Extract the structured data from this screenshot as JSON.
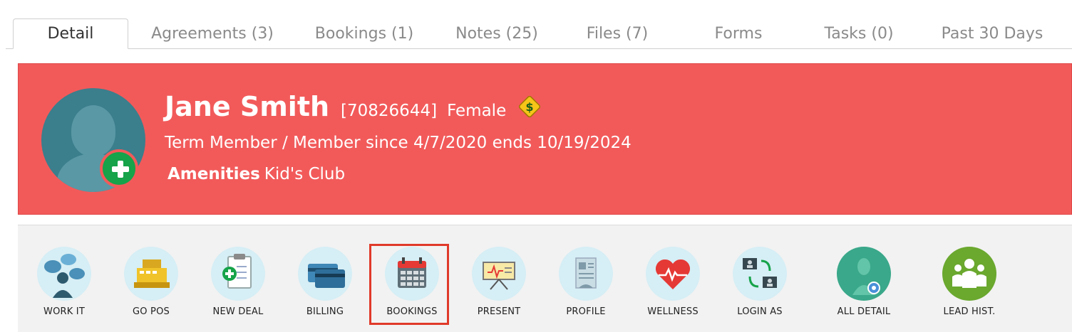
{
  "tabs": [
    {
      "label": "Detail",
      "active": true
    },
    {
      "label": "Agreements (3)"
    },
    {
      "label": "Bookings (1)"
    },
    {
      "label": "Notes (25)"
    },
    {
      "label": "Files (7)"
    },
    {
      "label": "Forms"
    },
    {
      "label": "Tasks (0)"
    },
    {
      "label": "Past 30 Days"
    }
  ],
  "member": {
    "name": "Jane Smith",
    "id": "[70826644]",
    "gender": "Female",
    "status_icon": "dollar-sign-warning-icon",
    "term": "Term Member / Member since 4/7/2020 ends 10/19/2024",
    "amenities_label": "Amenities",
    "amenities_value": "Kid's Club",
    "banner_color": "#f25a5a"
  },
  "toolbar": {
    "items": [
      {
        "label": "WORK IT",
        "icon": "chat-person-icon"
      },
      {
        "label": "GO POS",
        "icon": "cash-register-icon"
      },
      {
        "label": "NEW DEAL",
        "icon": "clipboard-plus-icon"
      },
      {
        "label": "BILLING",
        "icon": "credit-card-icon"
      },
      {
        "label": "BOOKINGS",
        "icon": "calendar-icon",
        "highlighted": true
      },
      {
        "label": "PRESENT",
        "icon": "presentation-board-icon"
      },
      {
        "label": "PROFILE",
        "icon": "profile-document-icon"
      },
      {
        "label": "WELLNESS",
        "icon": "heart-pulse-icon"
      },
      {
        "label": "LOGIN AS",
        "icon": "switch-user-icon"
      },
      {
        "label": "ALL DETAIL",
        "icon": "person-settings-icon"
      },
      {
        "label": "LEAD HIST.",
        "icon": "group-icon"
      }
    ],
    "highlight_color": "#e03a2a"
  }
}
